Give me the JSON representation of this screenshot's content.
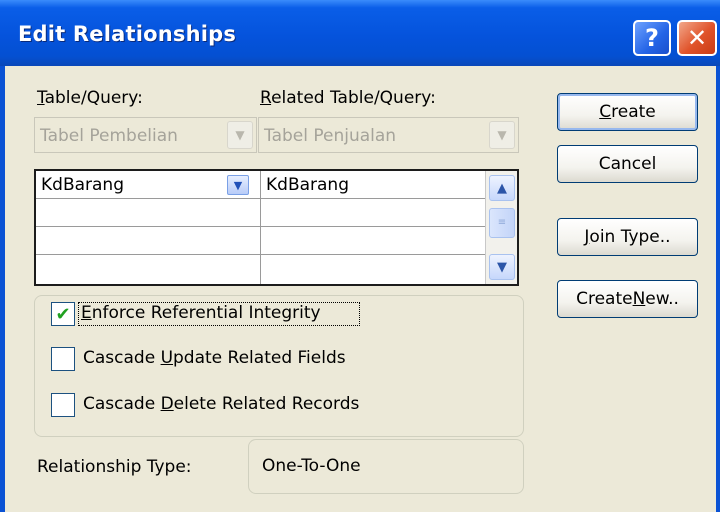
{
  "window": {
    "title": "Edit Relationships"
  },
  "titlebar": {
    "help": "?",
    "close": "✕"
  },
  "labels": {
    "table_query": {
      "pre": "",
      "hot": "T",
      "post": "able/Query:"
    },
    "related_table_query": {
      "pre": "",
      "hot": "R",
      "post": "elated Table/Query:"
    }
  },
  "combos": {
    "table": {
      "value": "Tabel Pembelian"
    },
    "related": {
      "value": "Tabel Penjualan"
    }
  },
  "grid": {
    "rows": [
      {
        "left": "KdBarang",
        "right": "KdBarang"
      },
      {
        "left": "",
        "right": ""
      },
      {
        "left": "",
        "right": ""
      },
      {
        "left": "",
        "right": ""
      }
    ]
  },
  "options": {
    "enforce": {
      "checked": true,
      "pre": "",
      "hot": "E",
      "post": "nforce Referential Integrity"
    },
    "cascade_update": {
      "checked": false,
      "pre": "Cascade ",
      "hot": "U",
      "post": "pdate Related Fields"
    },
    "cascade_delete": {
      "checked": false,
      "pre": "Cascade ",
      "hot": "D",
      "post": "elete Related Records"
    }
  },
  "relationship": {
    "label": "Relationship Type:",
    "value": "One-To-One"
  },
  "buttons": {
    "create": {
      "pre": "",
      "hot": "C",
      "post": "reate"
    },
    "cancel": {
      "pre": "Cancel",
      "hot": "",
      "post": ""
    },
    "join_type": {
      "pre": "",
      "hot": "J",
      "post": "oin Type.."
    },
    "create_new": {
      "pre": "Create ",
      "hot": "N",
      "post": "ew.."
    }
  },
  "icons": {
    "dropdown": "▼",
    "checkmark": "✔",
    "scroll_up": "▲",
    "scroll_down": "▼",
    "thumb": "≡"
  },
  "colors": {
    "titlebar": "#0553dc",
    "dialog_bg": "#ece9d8",
    "close": "#e0532a",
    "check": "#21a121"
  }
}
